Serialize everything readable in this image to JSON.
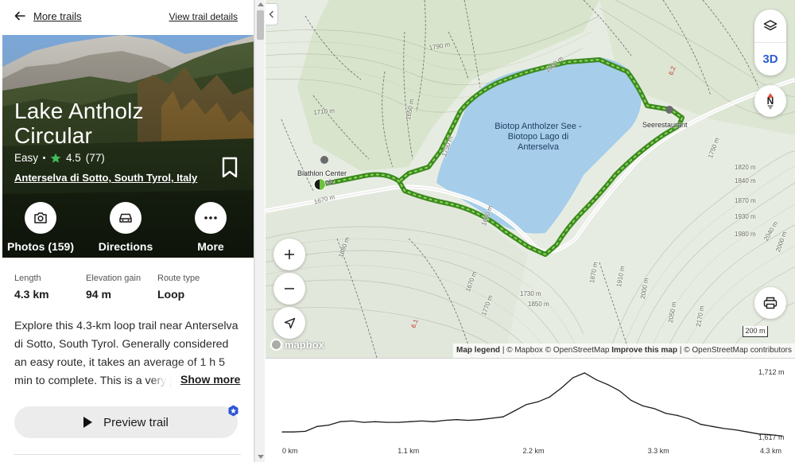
{
  "nav": {
    "back_label": "More trails",
    "details_label": "View trail details"
  },
  "trail": {
    "title": "Lake Antholz Circular",
    "difficulty": "Easy",
    "rating": "4.5",
    "review_count": "(77)",
    "location": "Anterselva di Sotto, South Tyrol, Italy"
  },
  "actions": [
    {
      "label": "Photos (159)",
      "icon": "camera-icon"
    },
    {
      "label": "Directions",
      "icon": "car-icon"
    },
    {
      "label": "More",
      "icon": "more-dots-icon"
    }
  ],
  "stats": [
    {
      "label": "Length",
      "value": "4.3 km"
    },
    {
      "label": "Elevation gain",
      "value": "94 m"
    },
    {
      "label": "Route type",
      "value": "Loop"
    }
  ],
  "description": "Explore this 4.3-km loop trail near Anterselva di Sotto, South Tyrol. Generally considered an easy route, it takes an average of 1 h 5 min to complete. This is a very popular area for hiking, so you'll likely encounter other people while exploring.",
  "show_more_label": "Show more",
  "preview_label": "Preview trail",
  "map": {
    "lake_label": "Biotop Antholzer See - Biotopo Lago di Anterselva",
    "poi_restaurant": "Seerestaurant",
    "poi_biathlon": "Biathlon Center",
    "poi_biathlon_suffix": "olz",
    "layer_3d_label": "3D",
    "north_label": "N",
    "scale_label": "200 m",
    "logo_text": "mapbox",
    "attribution": {
      "legend": "Map legend",
      "mapbox": "© Mapbox",
      "osm": "© OpenStreetMap",
      "improve": "Improve this map",
      "osm_contrib": "© OpenStreetMap contributors"
    },
    "contour_labels": [
      "1790 m",
      "1710 m",
      "1650 m",
      "1660 m",
      "1750 m",
      "1670 m",
      "1660 m",
      "1820 m",
      "1840 m",
      "1870 m",
      "1930 m",
      "1980 m",
      "1750 m",
      "2000 m",
      "2040 m",
      "1680 m",
      "1670 m",
      "1730 m",
      "1770 m",
      "1850 m",
      "1870 m",
      "1910 m",
      "2000 m",
      "2050 m",
      "2170 m"
    ],
    "colors": {
      "trail": "#4c9b2a",
      "lake": "#a6cdea",
      "terrain": "#e9eee4"
    }
  },
  "elevation": {
    "max_label": "1,712 m",
    "min_label": "1,617 m",
    "x_ticks": [
      "0 km",
      "1.1 km",
      "2.2 km",
      "3.3 km",
      "4.3 km"
    ]
  },
  "chart_data": {
    "type": "area",
    "x": [
      0,
      0.1,
      0.2,
      0.3,
      0.4,
      0.5,
      0.6,
      0.7,
      0.8,
      0.9,
      1.0,
      1.1,
      1.2,
      1.3,
      1.4,
      1.5,
      1.6,
      1.7,
      1.8,
      1.9,
      2.0,
      2.1,
      2.2,
      2.3,
      2.4,
      2.5,
      2.6,
      2.7,
      2.8,
      2.9,
      3.0,
      3.1,
      3.2,
      3.3,
      3.4,
      3.5,
      3.6,
      3.7,
      3.8,
      3.9,
      4.0,
      4.1,
      4.2,
      4.3
    ],
    "series": [
      {
        "values": [
          1626,
          1626,
          1627,
          1634,
          1636,
          1641,
          1642,
          1640,
          1641,
          1640,
          1640,
          1641,
          1642,
          1641,
          1643,
          1644,
          1643,
          1644,
          1646,
          1648,
          1657,
          1666,
          1670,
          1677,
          1690,
          1705,
          1712,
          1702,
          1695,
          1686,
          1672,
          1664,
          1660,
          1653,
          1650,
          1645,
          1637,
          1634,
          1631,
          1629,
          1626,
          1623,
          1622,
          1620
        ]
      }
    ],
    "xlim": [
      0,
      4.3
    ],
    "ylim": [
      1617,
      1712
    ],
    "xlabel": "",
    "ylabel": ""
  }
}
